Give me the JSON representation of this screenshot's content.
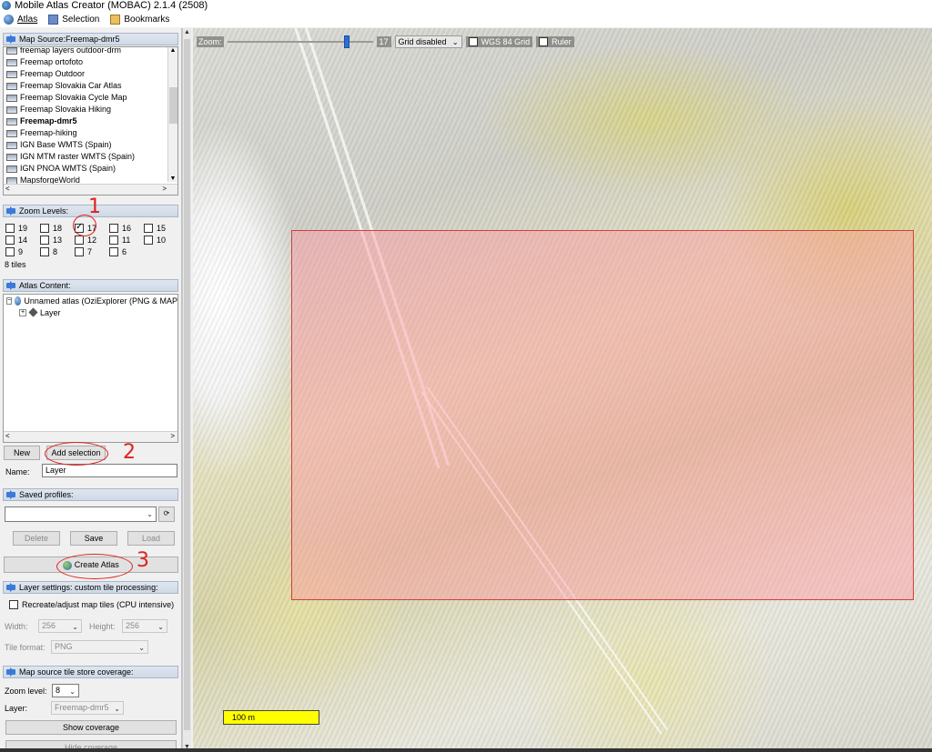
{
  "window": {
    "title": "Mobile Atlas Creator (MOBAC) 2.1.4 (2508)"
  },
  "menu": {
    "atlas": "Atlas",
    "selection": "Selection",
    "bookmarks": "Bookmarks"
  },
  "map_source": {
    "header": "Map Source:Freemap-dmr5",
    "items": [
      "freemap layers outdoor-drm",
      "Freemap ortofoto",
      "Freemap Outdoor",
      "Freemap Slovakia Car Atlas",
      "Freemap Slovakia Cycle Map",
      "Freemap Slovakia Hiking",
      "Freemap-dmr5",
      "Freemap-hiking",
      "IGN Base WMTS (Spain)",
      "IGN MTM raster WMTS (Spain)",
      "IGN PNOA WMTS (Spain)",
      "MapsforgeWorld"
    ],
    "selected_index": 6
  },
  "zoom_levels": {
    "header": "Zoom Levels:",
    "rows": [
      [
        {
          "label": "19"
        },
        {
          "label": "18"
        },
        {
          "label": "17",
          "checked": true
        },
        {
          "label": "16"
        },
        {
          "label": "15"
        }
      ],
      [
        {
          "label": "14"
        },
        {
          "label": "13"
        },
        {
          "label": "12"
        },
        {
          "label": "11"
        },
        {
          "label": "10"
        }
      ],
      [
        {
          "label": "9"
        },
        {
          "label": "8"
        },
        {
          "label": "7"
        },
        {
          "label": "6"
        }
      ]
    ],
    "tiles": "8 tiles"
  },
  "atlas_content": {
    "header": "Atlas Content:",
    "atlas_name": "Unnamed atlas (OziExplorer (PNG & MAP",
    "layer_node": "Layer",
    "new_label": "New",
    "add_selection_label": "Add selection",
    "name_label": "Name:",
    "name_value": "Layer"
  },
  "saved_profiles": {
    "header": "Saved profiles:",
    "delete_label": "Delete",
    "save_label": "Save",
    "load_label": "Load"
  },
  "create_atlas_label": "Create Atlas",
  "layer_settings": {
    "header": "Layer settings: custom tile processing:",
    "recreate_label": "Recreate/adjust map tiles (CPU intensive)",
    "width_label": "Width:",
    "width_value": "256",
    "height_label": "Height:",
    "height_value": "256",
    "format_label": "Tile format:",
    "format_value": "PNG"
  },
  "coverage": {
    "header": "Map source tile store coverage:",
    "zoom_label": "Zoom level:",
    "zoom_value": "8",
    "layer_label": "Layer:",
    "layer_value": "Freemap-dmr5",
    "show_label": "Show coverage",
    "hide_label": "Hide coverage"
  },
  "map": {
    "zoom_label": "Zoom:",
    "zoom_value": "17",
    "grid_option": "Grid disabled",
    "wgs84_label": "WGS 84 Grid",
    "ruler_label": "Ruler",
    "scale_label": "100 m"
  },
  "annotations": {
    "one": "1",
    "two": "2",
    "three": "3"
  },
  "colors": {
    "selection_fill": "#ff96a0",
    "selection_border": "#d04040",
    "scale_bar": "#ffff00",
    "annotation": "#e02020"
  }
}
